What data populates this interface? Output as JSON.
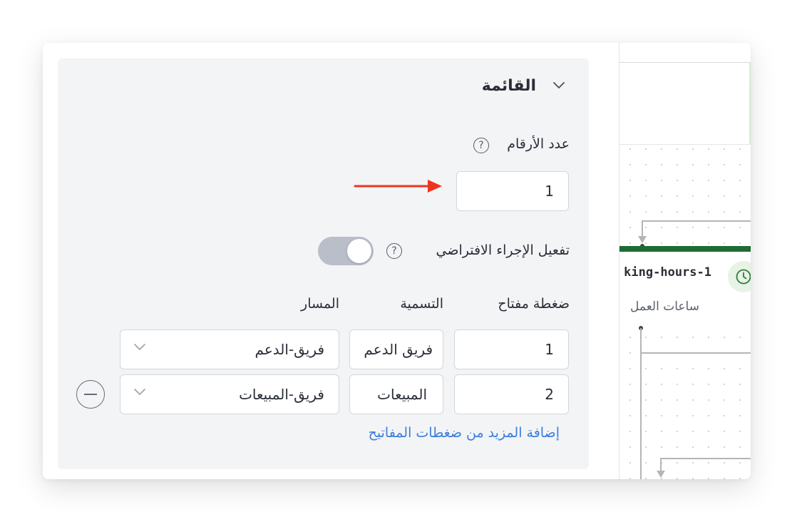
{
  "panel": {
    "section_title": "القائمة",
    "digits_label": "عدد الأرقام",
    "digits_value": "1",
    "default_action_label": "تفعيل الإجراء الافتراضي",
    "default_action_enabled": true,
    "help_glyph": "?",
    "columns": {
      "keypress": "ضغطة مفتاح",
      "label": "التسمية",
      "path": "المسار"
    },
    "rows": [
      {
        "key": "1",
        "label": "فريق الدعم",
        "path": "فريق-الدعم"
      },
      {
        "key": "2",
        "label": "المبيعات",
        "path": "فريق-المبيعات"
      }
    ],
    "add_more_link": "إضافة المزيد من ضغطات المفاتيح"
  },
  "canvas": {
    "node_title": "king-hours-1",
    "node_subtitle": "ساعات العمل",
    "node_bar_color": "#1f6b34",
    "node_icon": "clock-icon"
  },
  "colors": {
    "arrow": "#f0331d",
    "link": "#3b7ddd",
    "toggle_track": "#b9bec9"
  }
}
